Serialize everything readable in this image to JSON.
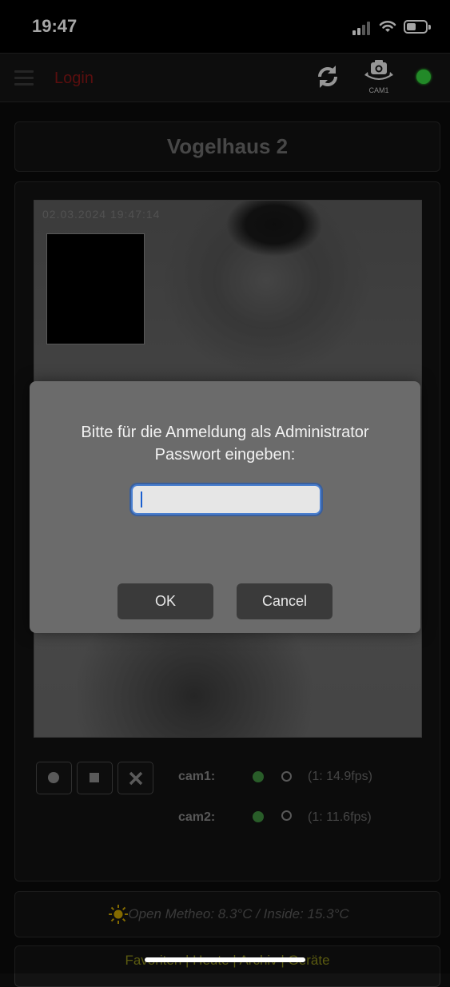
{
  "status": {
    "time": "19:47"
  },
  "topbar": {
    "login": "Login",
    "cam_label": "CAM1",
    "connection_color": "#35d33e",
    "icons": [
      "menu-icon",
      "refresh-icon",
      "camera-switch-icon"
    ]
  },
  "page": {
    "title": "Vogelhaus 2"
  },
  "stream": {
    "timestamp": "02.03.2024  19:47:14"
  },
  "controls": {
    "icons": [
      "record-icon",
      "stop-icon",
      "close-icon"
    ]
  },
  "cams": [
    {
      "label": "cam1:",
      "fps": "(1: 14.9fps)"
    },
    {
      "label": "cam2:",
      "fps": "(1: 11.6fps)"
    }
  ],
  "weather": {
    "text": "Open Metheo: 8.3°C / Inside: 15.3°C"
  },
  "footer": {
    "text": "Favoriten | Heute | Archiv | Geräte"
  },
  "dialog": {
    "message_line1": "Bitte für die Anmeldung als Administrator",
    "message_line2": "Passwort eingeben:",
    "password_value": "",
    "ok_label": "OK",
    "cancel_label": "Cancel"
  }
}
